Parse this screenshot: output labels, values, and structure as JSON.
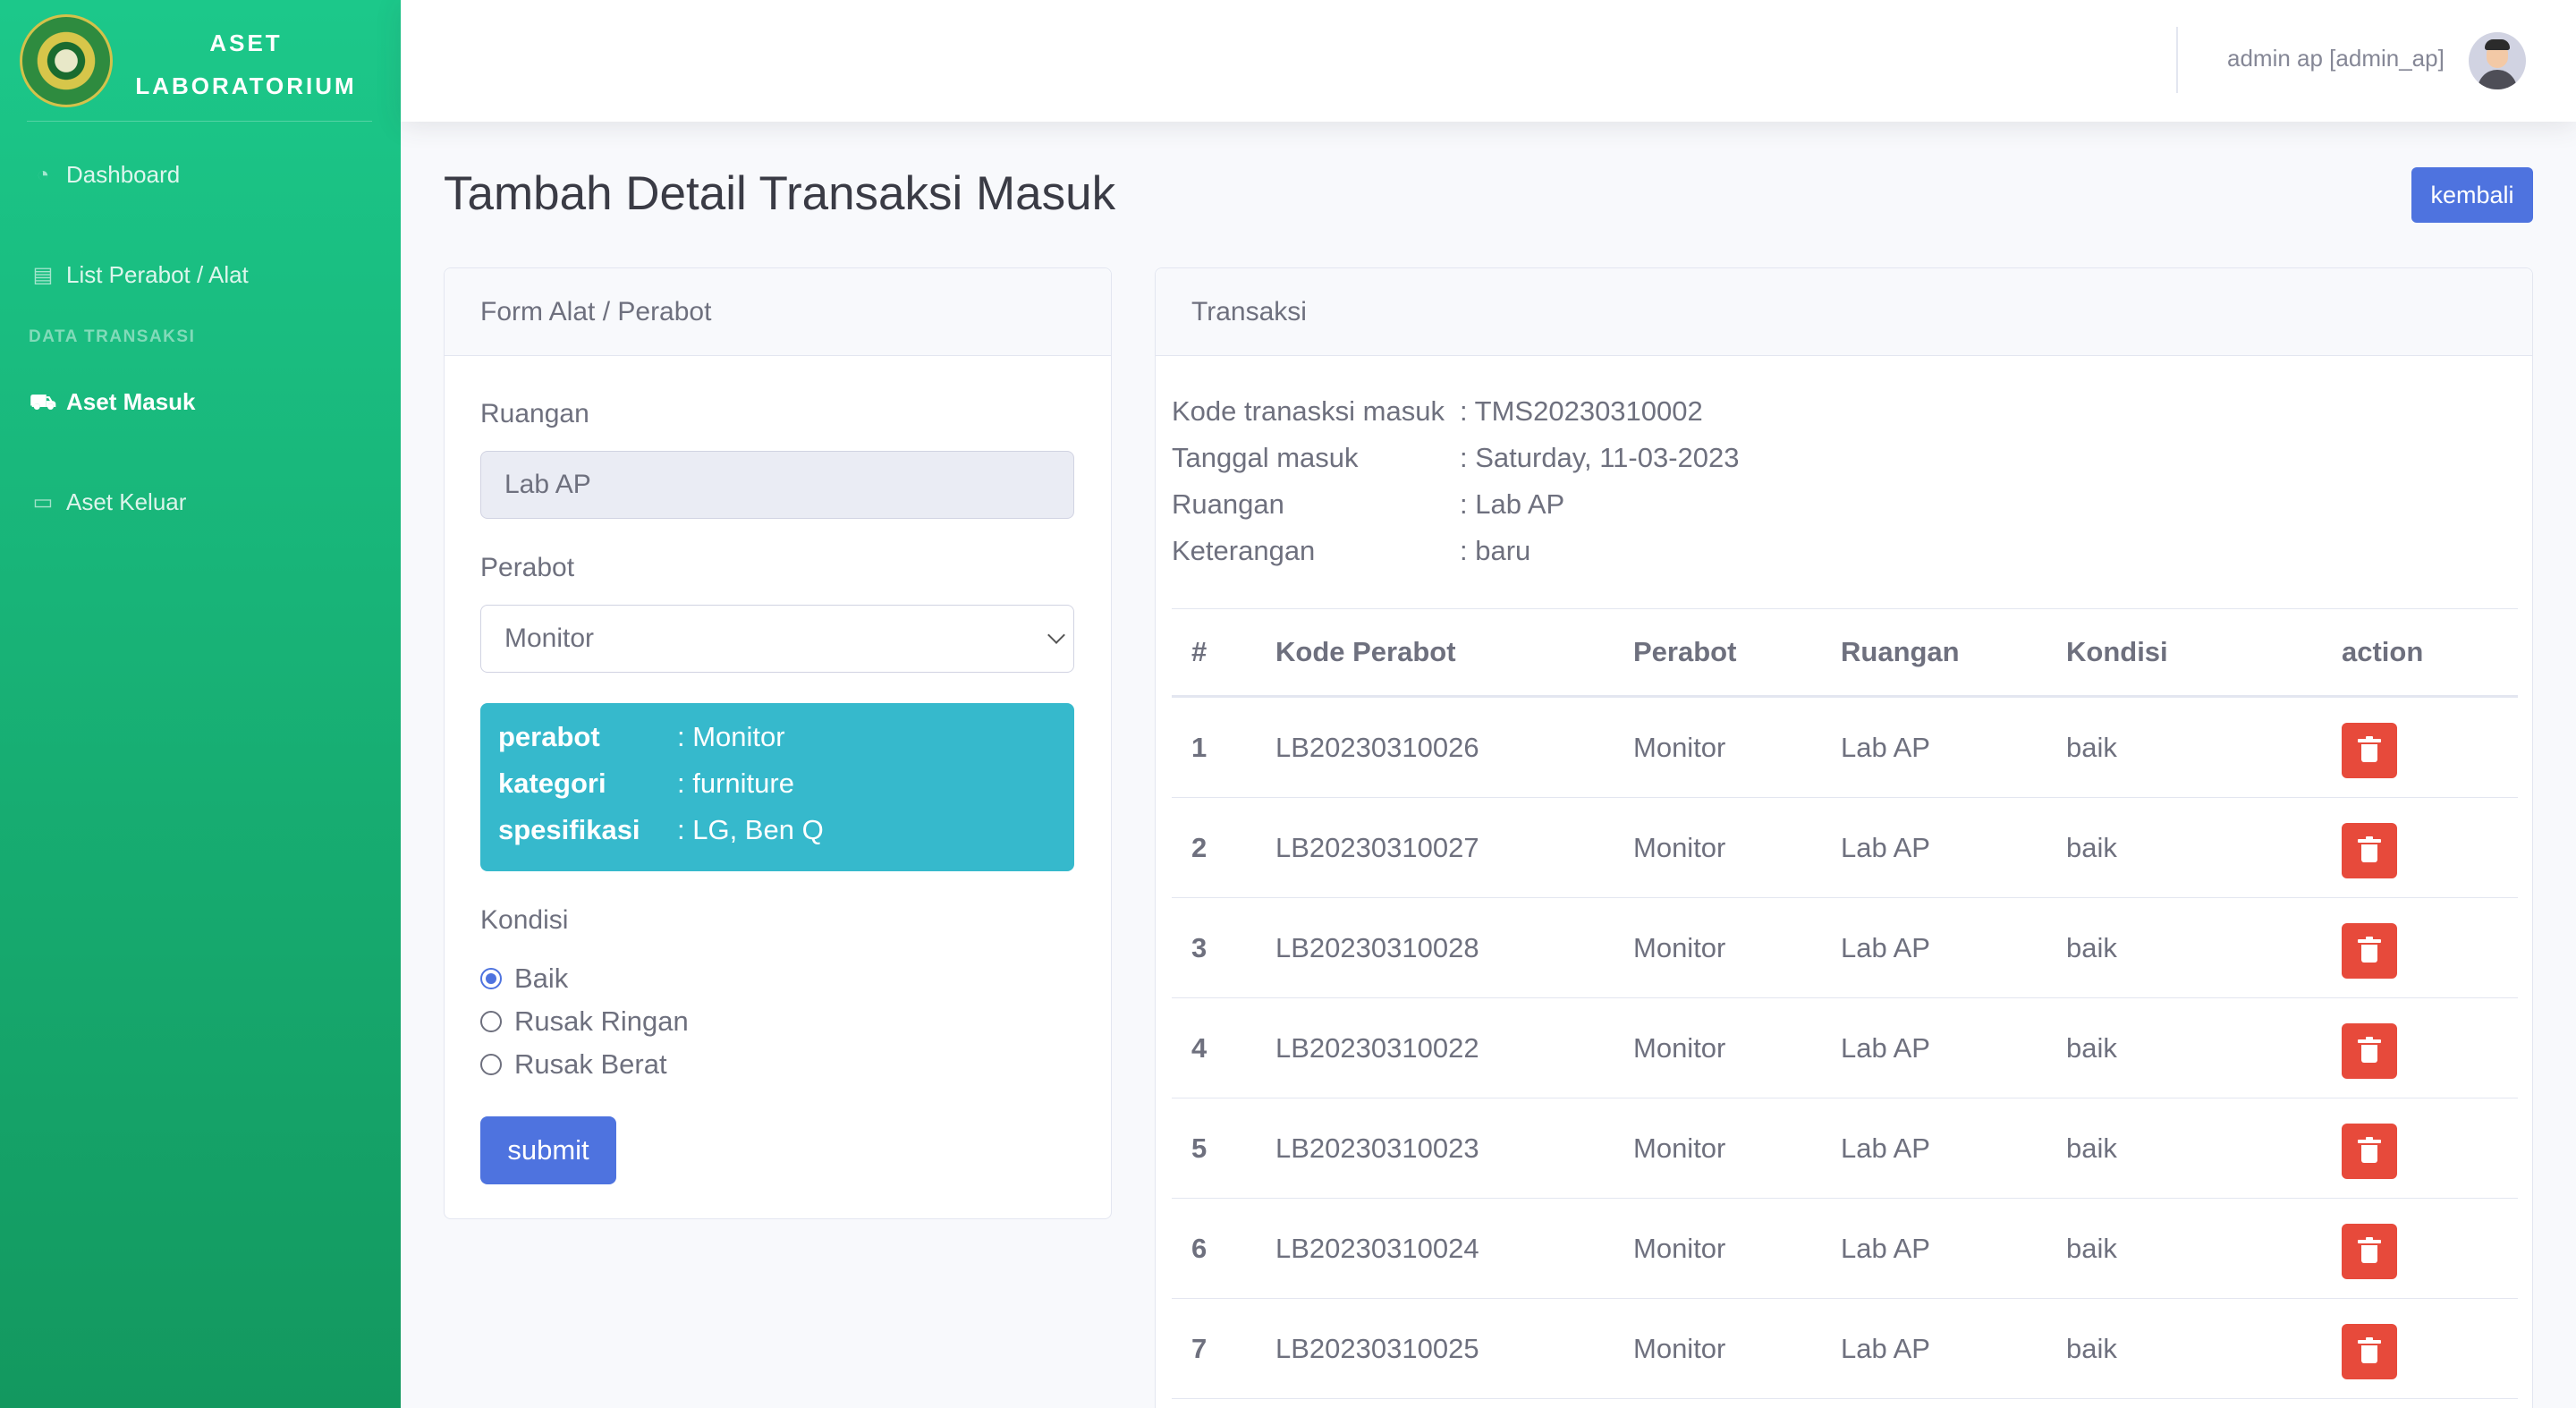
{
  "brand": {
    "line1": "ASET",
    "line2": "LABORATORIUM"
  },
  "sidebar": {
    "items": [
      {
        "label": "Dashboard",
        "icon": "tachometer-icon"
      },
      {
        "label": "List Perabot / Alat",
        "icon": "table-icon"
      },
      {
        "label": "Aset Masuk",
        "icon": "dolly-icon"
      },
      {
        "label": "Aset Keluar",
        "icon": "truck-icon"
      }
    ],
    "heading": "DATA TRANSAKSI",
    "active": "Aset Masuk"
  },
  "topbar": {
    "user": "admin ap [admin_ap]"
  },
  "page": {
    "title": "Tambah Detail Transaksi Masuk",
    "back_label": "kembali"
  },
  "form": {
    "header": "Form Alat / Perabot",
    "ruangan_label": "Ruangan",
    "ruangan_value": "Lab AP",
    "perabot_label": "Perabot",
    "perabot_selected": "Monitor",
    "info": [
      {
        "key": "perabot",
        "value": ": Monitor"
      },
      {
        "key": "kategori",
        "value": ": furniture"
      },
      {
        "key": "spesifikasi",
        "value": ": LG, Ben Q"
      }
    ],
    "kondisi_label": "Kondisi",
    "kondisi_options": [
      "Baik",
      "Rusak Ringan",
      "Rusak Berat"
    ],
    "kondisi_selected": "Baik",
    "submit_label": "submit"
  },
  "transaksi": {
    "header": "Transaksi",
    "meta": [
      {
        "key": "Kode tranasksi masuk",
        "value": ": TMS20230310002"
      },
      {
        "key": "Tanggal masuk",
        "value": ": Saturday, 11-03-2023"
      },
      {
        "key": "Ruangan",
        "value": ": Lab AP"
      },
      {
        "key": "Keterangan",
        "value": ": baru"
      }
    ],
    "columns": [
      "#",
      "Kode Perabot",
      "Perabot",
      "Ruangan",
      "Kondisi",
      "action"
    ],
    "rows": [
      [
        "1",
        "LB20230310026",
        "Monitor",
        "Lab AP",
        "baik"
      ],
      [
        "2",
        "LB20230310027",
        "Monitor",
        "Lab AP",
        "baik"
      ],
      [
        "3",
        "LB20230310028",
        "Monitor",
        "Lab AP",
        "baik"
      ],
      [
        "4",
        "LB20230310022",
        "Monitor",
        "Lab AP",
        "baik"
      ],
      [
        "5",
        "LB20230310023",
        "Monitor",
        "Lab AP",
        "baik"
      ],
      [
        "6",
        "LB20230310024",
        "Monitor",
        "Lab AP",
        "baik"
      ],
      [
        "7",
        "LB20230310025",
        "Monitor",
        "Lab AP",
        "baik"
      ]
    ]
  },
  "colors": {
    "sidebar_top": "#1cc88a",
    "sidebar_bottom": "#13985f",
    "primary": "#4e73df",
    "info": "#36b9cc",
    "danger": "#e74a3b"
  }
}
